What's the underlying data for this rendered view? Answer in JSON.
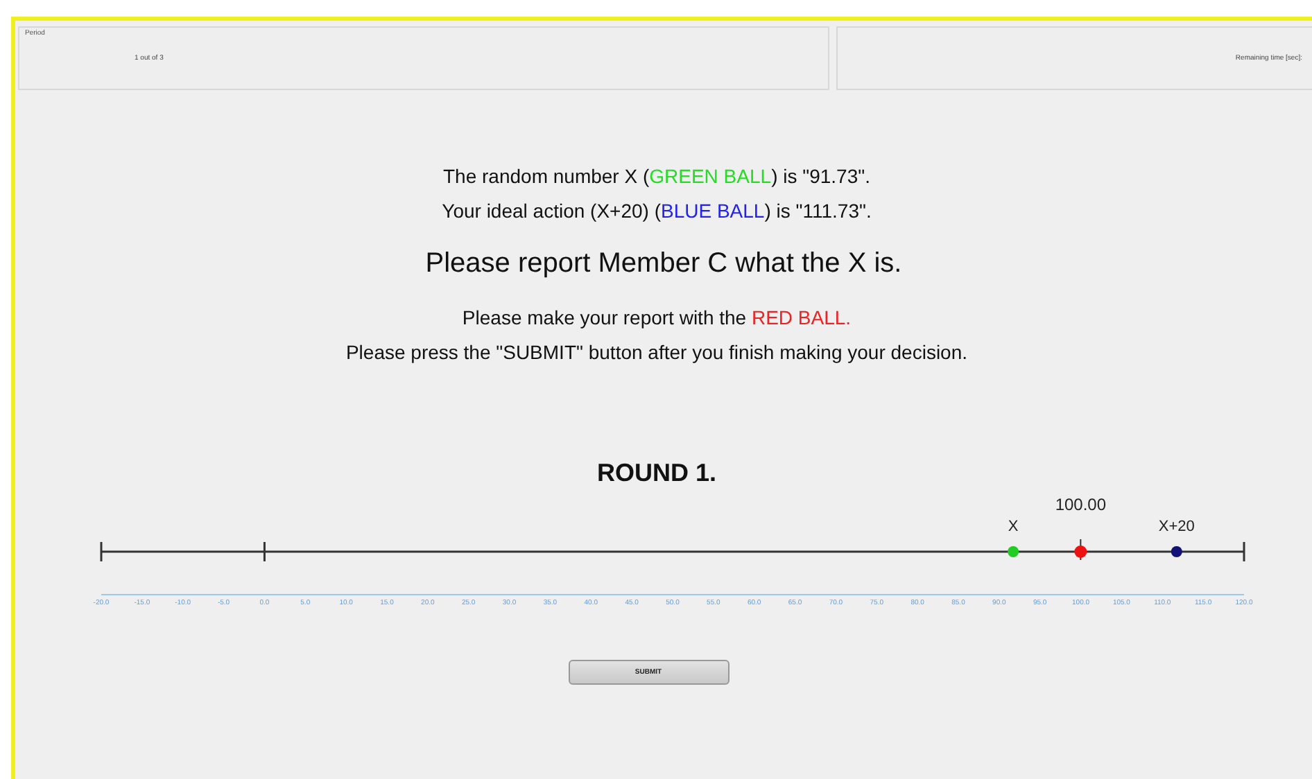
{
  "header": {
    "period_label": "Period",
    "period_value": "1 out of 3",
    "remaining_label": "Remaining time [sec]:"
  },
  "messages": [
    {
      "kind": "line",
      "segments": [
        {
          "text": "The random number X ("
        },
        {
          "text": "GREEN BALL",
          "color": "#22dd22"
        },
        {
          "text": ") is \"91.73\"."
        }
      ]
    },
    {
      "kind": "line",
      "segments": [
        {
          "text": "Your ideal action (X+20)  ("
        },
        {
          "text": "BLUE BALL",
          "color": "#2222ee"
        },
        {
          "text": ") is \"111.73\"."
        }
      ]
    },
    {
      "kind": "heading",
      "segments": [
        {
          "text": "Please report Member C what the X is."
        }
      ]
    },
    {
      "kind": "line",
      "segments": [
        {
          "text": "Please make your report with the "
        },
        {
          "text": "RED BALL.",
          "color": "#ee2222"
        }
      ]
    },
    {
      "kind": "line",
      "segments": [
        {
          "text": "Please press the \"SUBMIT\" button after you finish making your decision."
        }
      ]
    }
  ],
  "round": "ROUND 1.",
  "number_line": {
    "markers": [
      {
        "kind": "dot",
        "label": "X",
        "level": 0.798,
        "color": "#22cc22"
      },
      {
        "kind": "thumb",
        "label": "100.00",
        "level": 0.857,
        "color": "#ee1111"
      },
      {
        "kind": "dot",
        "label": "X+20",
        "level": 0.941,
        "color": "#111177"
      }
    ],
    "ticks": [
      "-20.0",
      "-15.0",
      "-10.0",
      "-5.0",
      "0.0",
      "5.0",
      "10.0",
      "15.0",
      "20.0",
      "25.0",
      "30.0",
      "35.0",
      "40.0",
      "45.0",
      "50.0",
      "55.0",
      "60.0",
      "65.0",
      "70.0",
      "75.0",
      "80.0",
      "85.0",
      "90.0",
      "95.0",
      "100.0",
      "105.0",
      "110.0",
      "115.0",
      "120.0"
    ]
  },
  "submit": "SUBMIT"
}
